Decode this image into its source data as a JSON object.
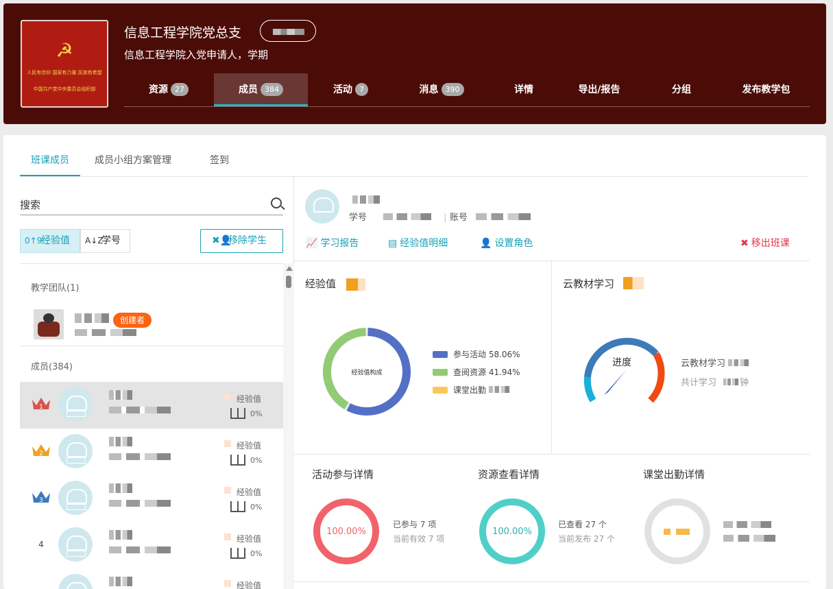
{
  "header": {
    "cover": {
      "slogan": "人民有信仰 国家有力量 民族有希望",
      "org": "中国共产党中央委员会组织部"
    },
    "title": "信息工程学院党总支",
    "subtitle": "信息工程学院入党申请人，学期",
    "nav": [
      {
        "label": "资源",
        "badge": "27"
      },
      {
        "label": "成员",
        "badge": "384"
      },
      {
        "label": "活动",
        "badge": "7"
      },
      {
        "label": "消息",
        "badge": "390"
      },
      {
        "label": "详情",
        "badge": ""
      },
      {
        "label": "导出/报告",
        "badge": ""
      },
      {
        "label": "分组",
        "badge": ""
      },
      {
        "label": "发布教学包",
        "badge": ""
      }
    ]
  },
  "tabs": [
    "班课成员",
    "成员小组方案管理",
    "签到"
  ],
  "left": {
    "search_placeholder": "搜索",
    "sort_exp": "经验值",
    "sort_no": "学号",
    "remove_btn": "移除学生",
    "team_label": "教学团队(1)",
    "creator_badge": "创建者",
    "members_label": "成员(384)",
    "rows": [
      {
        "rank": "1",
        "exp_label": "经验值",
        "pct": "0%"
      },
      {
        "rank": "2",
        "exp_label": "经验值",
        "pct": "0%"
      },
      {
        "rank": "3",
        "exp_label": "经验值",
        "pct": "0%"
      },
      {
        "rank": "4",
        "exp_label": "经验值",
        "pct": "0%"
      },
      {
        "rank": "",
        "exp_label": "经验值",
        "pct": ""
      }
    ]
  },
  "right": {
    "student_no_label": "学号",
    "account_label": "账号",
    "actions": {
      "report": "学习报告",
      "detail": "经验值明细",
      "role": "设置角色",
      "remove": "移出班课"
    },
    "exp_title": "经验值",
    "donut_center": "经验值构成",
    "legend": [
      {
        "label": "参与活动 58.06%",
        "color": "#5470c6"
      },
      {
        "label": "查阅资源 41.94%",
        "color": "#91cc75"
      },
      {
        "label": "课堂出勤",
        "color": "#fac858"
      }
    ],
    "cloud_title": "云教材学习",
    "gauge_label": "进度",
    "cloud_line1": "云教材学习",
    "cloud_line2": "共计学习",
    "cloud_line2_tail": "钟",
    "activity": {
      "title": "活动参与详情",
      "pct": "100.00%",
      "line1": "已参与 7 项",
      "line2": "当前有效 7 项"
    },
    "resource": {
      "title": "资源查看详情",
      "pct": "100.00%",
      "line1": "已查看 27 个",
      "line2": "当前发布 27 个"
    },
    "attend": {
      "title": "课堂出勤详情"
    }
  }
}
